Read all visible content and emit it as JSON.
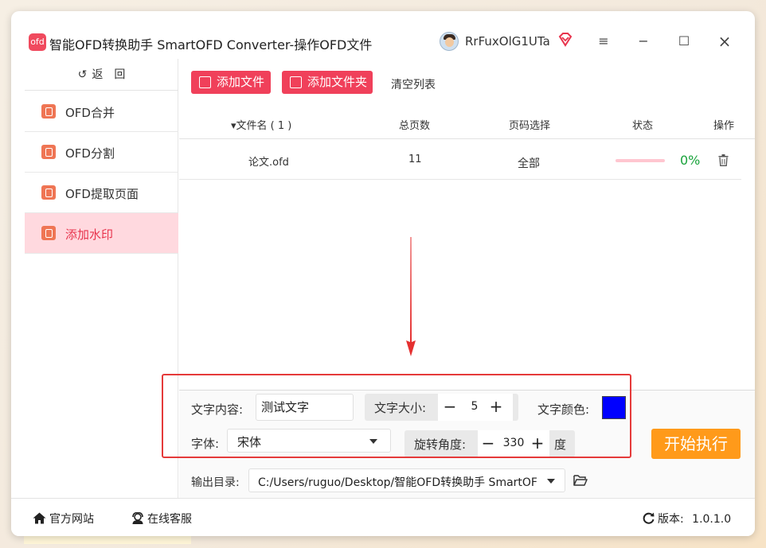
{
  "app": {
    "title": "智能OFD转换助手 SmartOFD Converter-操作OFD文件",
    "logo_text": "ofd",
    "username": "RrFuxOlG1UTa"
  },
  "window_controls": {
    "menu": "≡",
    "minimize": "−",
    "maximize": "☐",
    "close": "×"
  },
  "sidebar": {
    "back_label": "返　回",
    "back_arrow": "↺",
    "items": [
      {
        "label": "OFD合并",
        "active": false
      },
      {
        "label": "OFD分割",
        "active": false
      },
      {
        "label": "OFD提取页面",
        "active": false
      },
      {
        "label": "添加水印",
        "active": true
      }
    ]
  },
  "toolbar": {
    "add_file": "添加文件",
    "add_folder": "添加文件夹",
    "clear_list": "清空列表"
  },
  "table": {
    "headers": {
      "filename": "▾文件名 ( 1 )",
      "pages": "总页数",
      "page_select": "页码选择",
      "status": "状态",
      "action": "操作"
    },
    "rows": [
      {
        "filename": "论文.ofd",
        "pages": "11",
        "page_select": "全部",
        "progress": 0,
        "progress_text": "0%"
      }
    ]
  },
  "watermark": {
    "text_label": "文字内容:",
    "text_value": "测试文字",
    "size_label": "文字大小:",
    "size_value": "5",
    "color_label": "文字颜色:",
    "color_value": "#0000ff",
    "font_label": "字体:",
    "font_value": "宋体",
    "rotation_label": "旋转角度:",
    "rotation_value": "330",
    "rotation_unit": "度",
    "minus": "−",
    "plus": "+"
  },
  "output": {
    "label": "输出目录:",
    "path": "C:/Users/ruguo/Desktop/智能OFD转换助手 SmartOFD Converter"
  },
  "actions": {
    "start": "开始执行"
  },
  "footer": {
    "website": "官方网站",
    "support": "在线客服",
    "version_label": "版本:",
    "version": "1.0.1.0"
  },
  "colors": {
    "accent_red": "#f0405a",
    "active_bg": "#ffd9df",
    "start_orange": "#ff9a1a",
    "progress_green": "#1aa33c"
  }
}
